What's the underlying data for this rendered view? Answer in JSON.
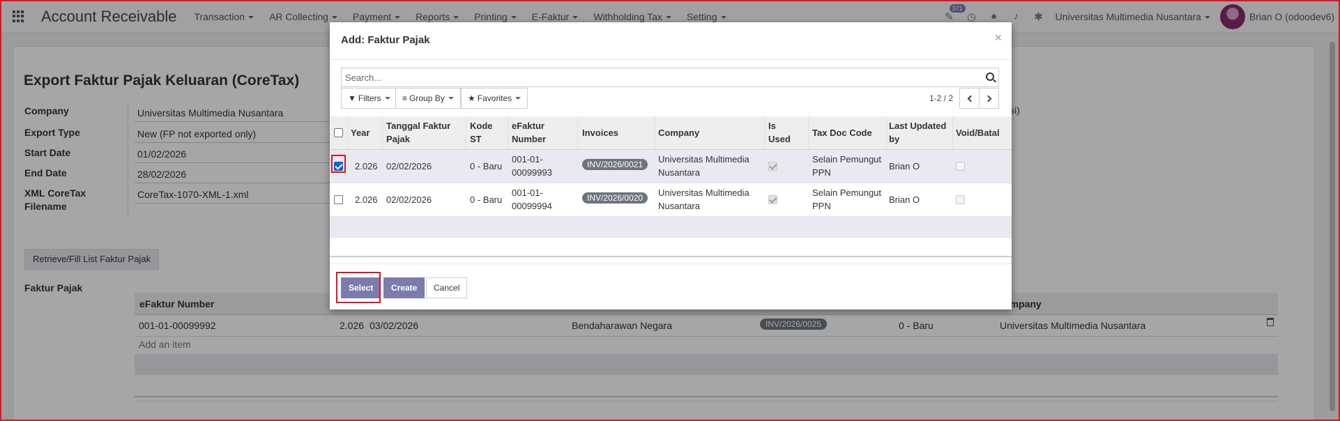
{
  "navbar": {
    "app_title": "Account Receivable",
    "menu": [
      "Transaction",
      "AR Collecting",
      "Payment",
      "Reports",
      "Printing",
      "E-Faktur",
      "Withholding Tax",
      "Setting"
    ],
    "activity_badge": "371",
    "company": "Universitas Multimedia Nusantara",
    "user": "Brian O (odoodev6)"
  },
  "form": {
    "title": "Export Faktur Pajak Keluaran (CoreTax)",
    "fields": [
      {
        "label": "Company",
        "value": "Universitas Multimedia Nusantara"
      },
      {
        "label": "Export Type",
        "value": "New (FP not exported only)"
      },
      {
        "label": "Start Date",
        "value": "01/02/2026"
      },
      {
        "label": "End Date",
        "value": "28/02/2026"
      },
      {
        "label": "XML CoreTax Filename",
        "value": "CoreTax-1070-XML-1.xml"
      }
    ],
    "right_fragment": "si)",
    "retrieve_button": "Retrieve/Fill List Faktur Pajak",
    "faktur_label": "Faktur Pajak",
    "table_head": {
      "efaktur": "eFaktur Number",
      "company": "ompany"
    },
    "row": {
      "efaktur": "001-01-00099992",
      "year": "2.026",
      "date": "03/02/2026",
      "partner": "Bendaharawan Negara",
      "invoice": "INV/2026/0025",
      "kode": "0 - Baru",
      "company": "Universitas Multimedia Nusantara"
    },
    "add_item": "Add an item"
  },
  "modal": {
    "title": "Add: Faktur Pajak",
    "close": "×",
    "search_placeholder": "Search...",
    "filters": "Filters",
    "group_by": "Group By",
    "favorites": "Favorites",
    "pager": "1-2 / 2",
    "columns": {
      "year": "Year",
      "tanggal_1": "Tanggal Faktur",
      "tanggal_2": "Pajak",
      "kode_1": "Kode",
      "kode_2": "ST",
      "efaktur_1": "eFaktur",
      "efaktur_2": "Number",
      "invoices": "Invoices",
      "company": "Company",
      "used_1": "Is",
      "used_2": "Used",
      "taxdoc": "Tax Doc Code",
      "updated_1": "Last Updated",
      "updated_2": "by",
      "void": "Void/Batal"
    },
    "rows": [
      {
        "selected": true,
        "year": "2.026",
        "date": "02/02/2026",
        "kode": "0 - Baru",
        "efaktur_1": "001-01-",
        "efaktur_2": "00099993",
        "invoice": "INV/2026/0021",
        "company_1": "Universitas Multimedia",
        "company_2": "Nusantara",
        "is_used": true,
        "taxdoc_1": "Selain Pemungut",
        "taxdoc_2": "PPN",
        "updated_by": "Brian O",
        "void": false
      },
      {
        "selected": false,
        "year": "2.026",
        "date": "02/02/2026",
        "kode": "0 - Baru",
        "efaktur_1": "001-01-",
        "efaktur_2": "00099994",
        "invoice": "INV/2026/0020",
        "company_1": "Universitas Multimedia",
        "company_2": "Nusantara",
        "is_used": true,
        "taxdoc_1": "Selain Pemungut",
        "taxdoc_2": "PPN",
        "updated_by": "Brian O",
        "void": false
      }
    ],
    "buttons": {
      "select": "Select",
      "create": "Create",
      "cancel": "Cancel"
    }
  },
  "colors": {
    "accent": "#7c7bad",
    "highlight": "#e0141e",
    "pill": "#6c757d"
  }
}
